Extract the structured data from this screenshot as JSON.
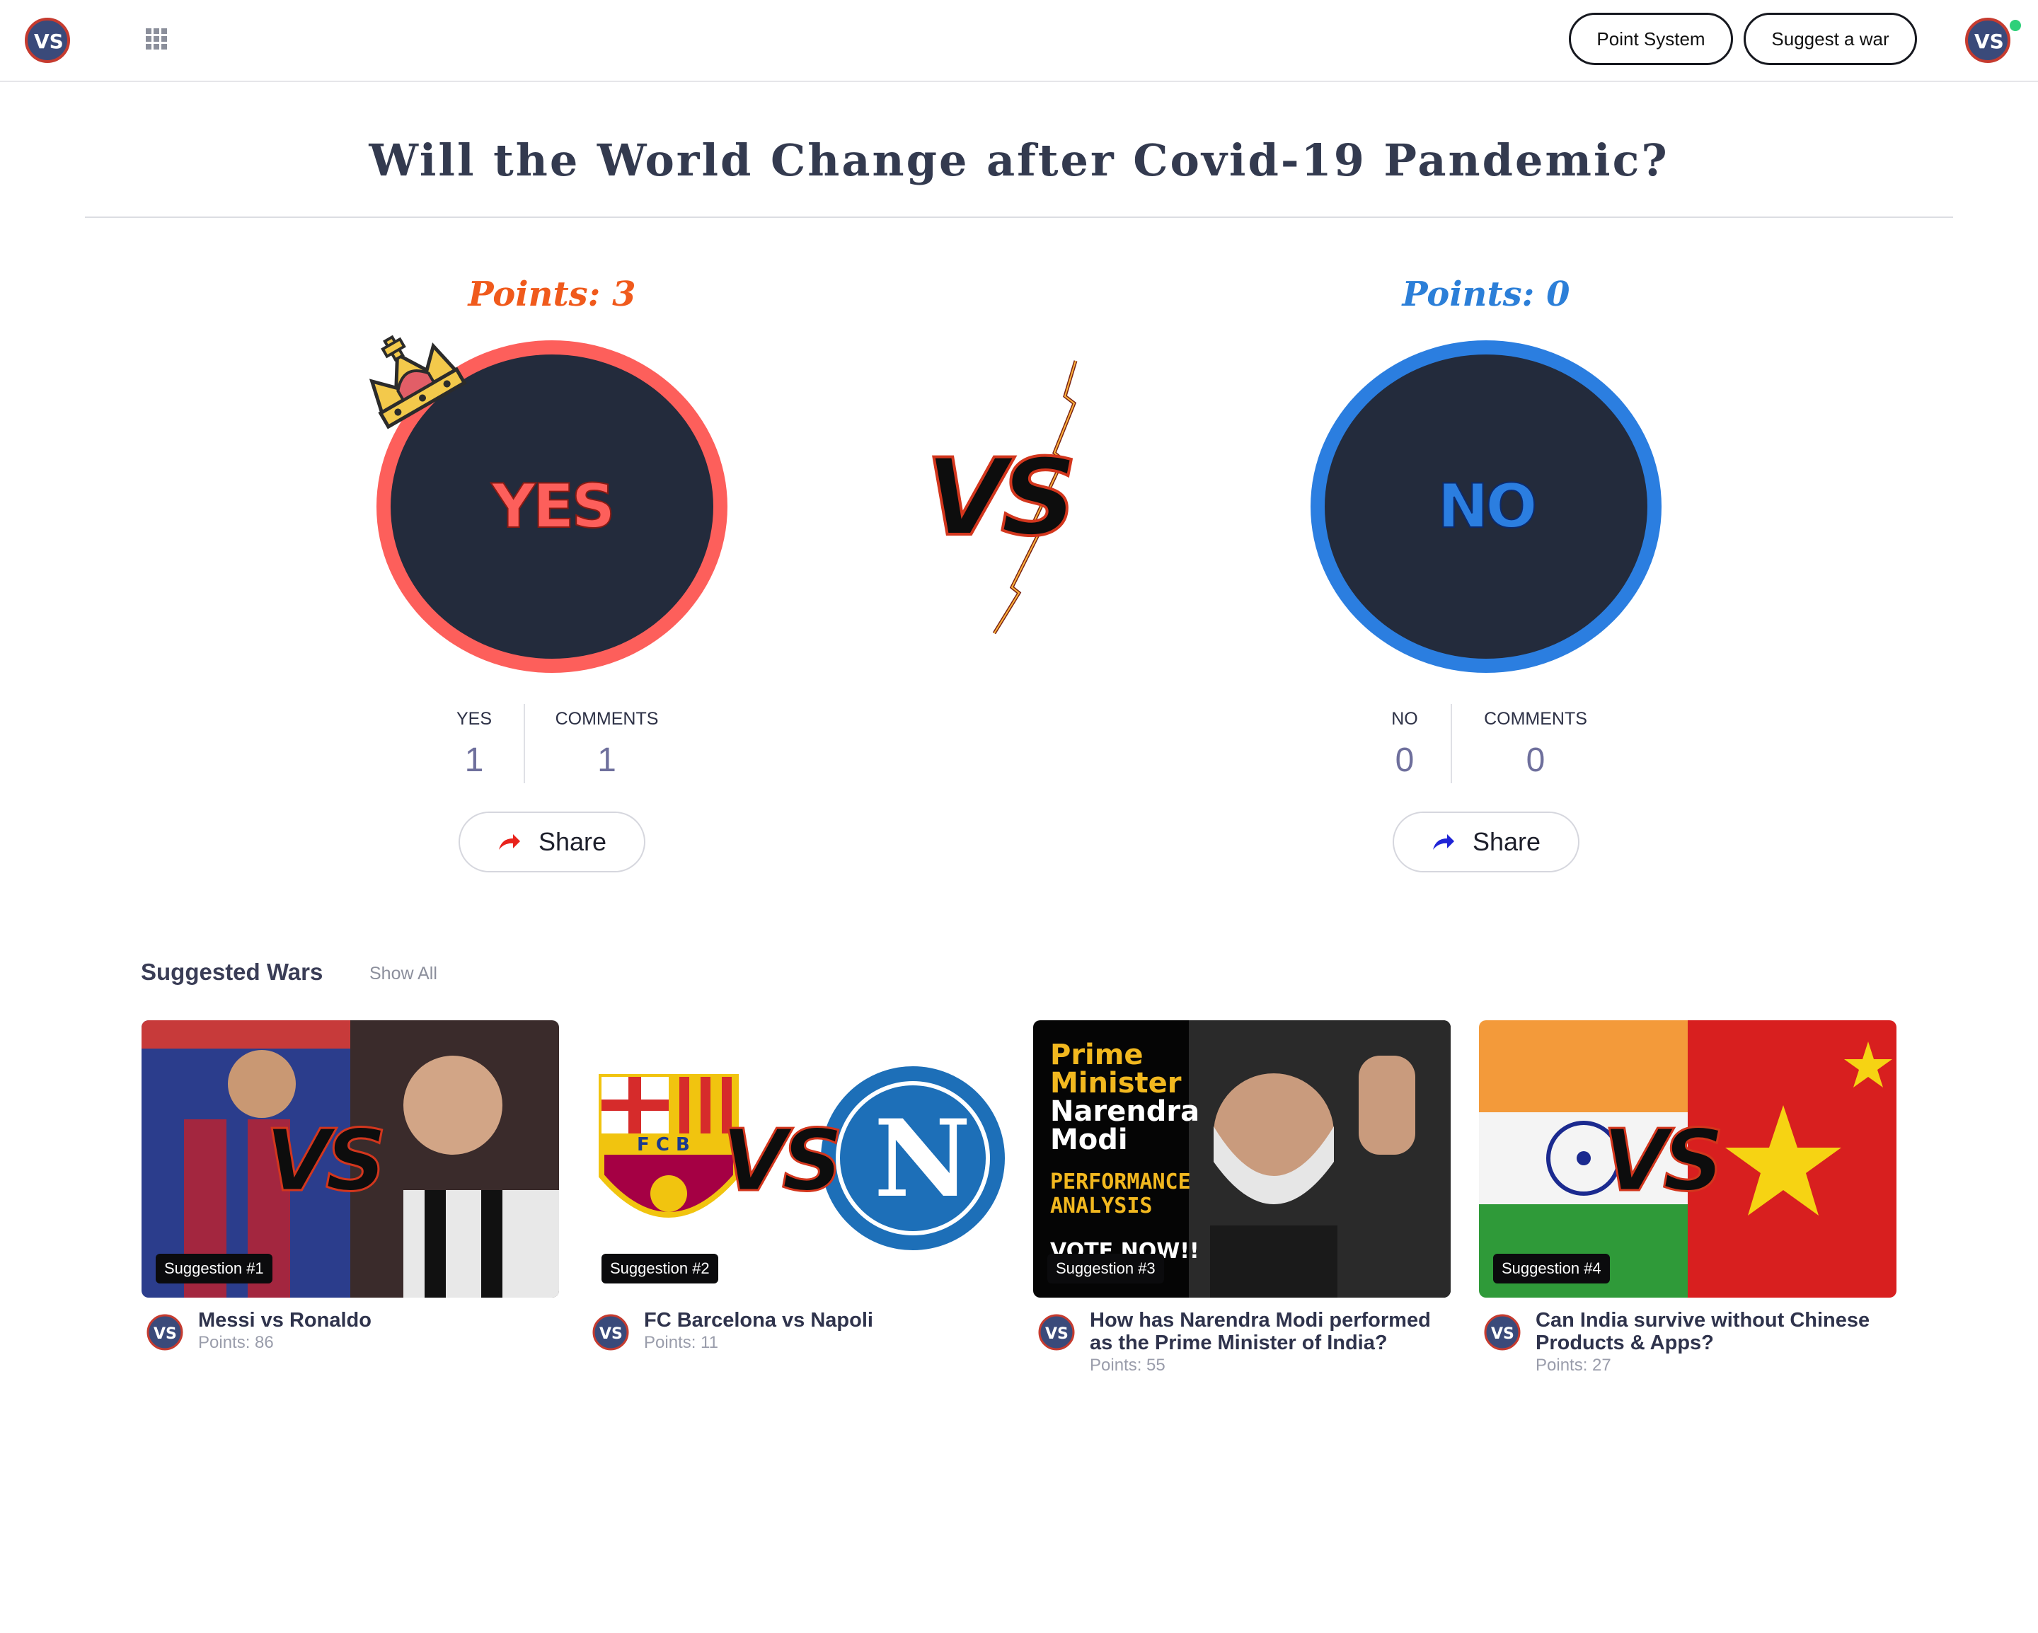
{
  "header": {
    "point_system_label": "Point System",
    "suggest_war_label": "Suggest a war"
  },
  "war": {
    "title": "Will the World Change after Covid-19 Pandemic?",
    "yes": {
      "points_label": "Points: 3",
      "circle_label": "YES",
      "votes_caption": "YES",
      "votes_value": "1",
      "comments_caption": "COMMENTS",
      "comments_value": "1",
      "share_label": "Share",
      "color": "#fd5f5b"
    },
    "no": {
      "points_label": "Points: 0",
      "circle_label": "NO",
      "votes_caption": "NO",
      "votes_value": "0",
      "comments_caption": "COMMENTS",
      "comments_value": "0",
      "share_label": "Share",
      "color": "#2b7ee0"
    }
  },
  "suggested": {
    "heading": "Suggested Wars",
    "show_all": "Show All",
    "cards": [
      {
        "badge": "Suggestion #1",
        "title": "Messi vs Ronaldo",
        "points": "Points: 86"
      },
      {
        "badge": "Suggestion #2",
        "title": "FC Barcelona vs Napoli",
        "points": "Points: 11"
      },
      {
        "badge": "Suggestion #3",
        "title": "How has Narendra Modi performed as the Prime Minister of India?",
        "points": "Points: 55",
        "thumb_text": {
          "line1": "Prime",
          "line2": "Minister",
          "line3": "Narendra",
          "line4": "Modi",
          "line5": "PERFORMANCE",
          "line6": "ANALYSIS",
          "line7": "VOTE NOW!!"
        }
      },
      {
        "badge": "Suggestion #4",
        "title": "Can India survive without Chinese Products & Apps?",
        "points": "Points: 27"
      }
    ]
  }
}
